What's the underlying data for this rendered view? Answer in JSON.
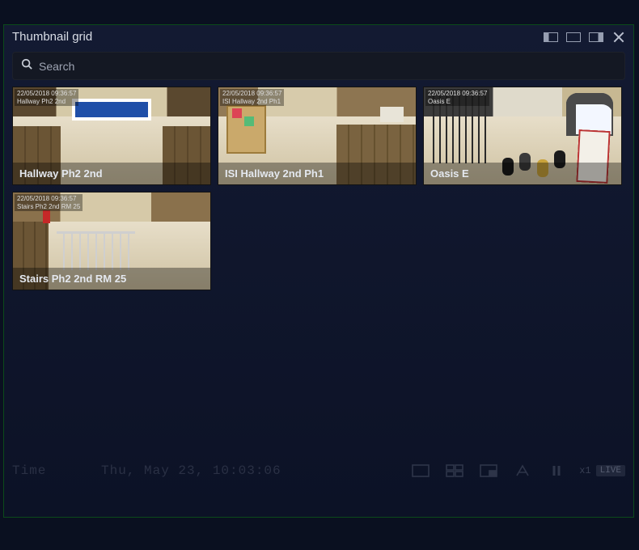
{
  "window": {
    "title": "Thumbnail grid"
  },
  "search": {
    "placeholder": "Search",
    "value": ""
  },
  "cameras": [
    {
      "label": "Hallway Ph2 2nd",
      "overlay": "22/05/2018 09:36:57\nHallway Ph2 2nd"
    },
    {
      "label": "ISI Hallway 2nd Ph1",
      "overlay": "22/05/2018 09:36:57\nISI Hallway 2nd Ph1"
    },
    {
      "label": "Oasis E",
      "overlay": "22/05/2018 09:36:57\nOasis E"
    },
    {
      "label": "Stairs Ph2 2nd RM 25",
      "overlay": "22/05/2018 09:36:57\nStairs Ph2 2nd RM 25"
    }
  ],
  "timeline": {
    "label": "Time",
    "timestamp": "Thu, May 23, 10:03:06",
    "speed": "x1",
    "live": "LIVE"
  }
}
